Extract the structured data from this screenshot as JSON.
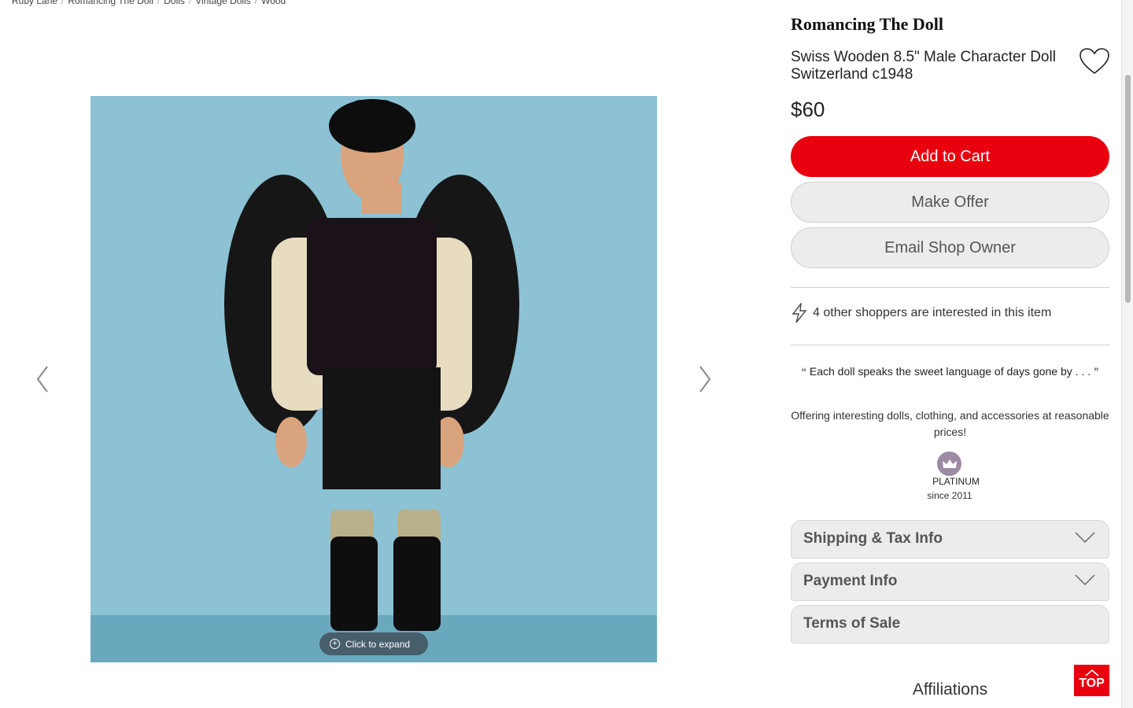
{
  "breadcrumb": [
    "Ruby Lane",
    "Romancing The Doll",
    "Dolls",
    "Vintage Dolls",
    "Wood"
  ],
  "gallery": {
    "expand_label": "Click to expand",
    "prev_icon": "chevron-left-icon",
    "next_icon": "chevron-right-icon"
  },
  "listing": {
    "shop_name": "Romancing The Doll",
    "title": "Swiss Wooden 8.5\" Male Character Doll Switzerland c1948",
    "price": "$60"
  },
  "actions": {
    "add_to_cart": "Add to Cart",
    "make_offer": "Make Offer",
    "email_owner": "Email Shop Owner"
  },
  "interest": {
    "text": "4 other shoppers are interested in this item",
    "icon": "lightning-icon"
  },
  "shop_info": {
    "tagline": "Each doll speaks the sweet language of days gone by . . .",
    "offering": "Offering interesting dolls, clothing, and accessories at reasonable prices!",
    "tier": "PLATINUM",
    "since": "since 2011"
  },
  "accordions": [
    {
      "label": "Shipping & Tax Info"
    },
    {
      "label": "Payment Info"
    },
    {
      "label": "Terms of Sale"
    }
  ],
  "affiliations_title": "Affiliations",
  "top_button": "TOP",
  "colors": {
    "accent": "#e8000f",
    "button_grey": "#ececec",
    "photo_bg": "#8cc2d4",
    "platinum_badge": "#9d8aa3"
  }
}
